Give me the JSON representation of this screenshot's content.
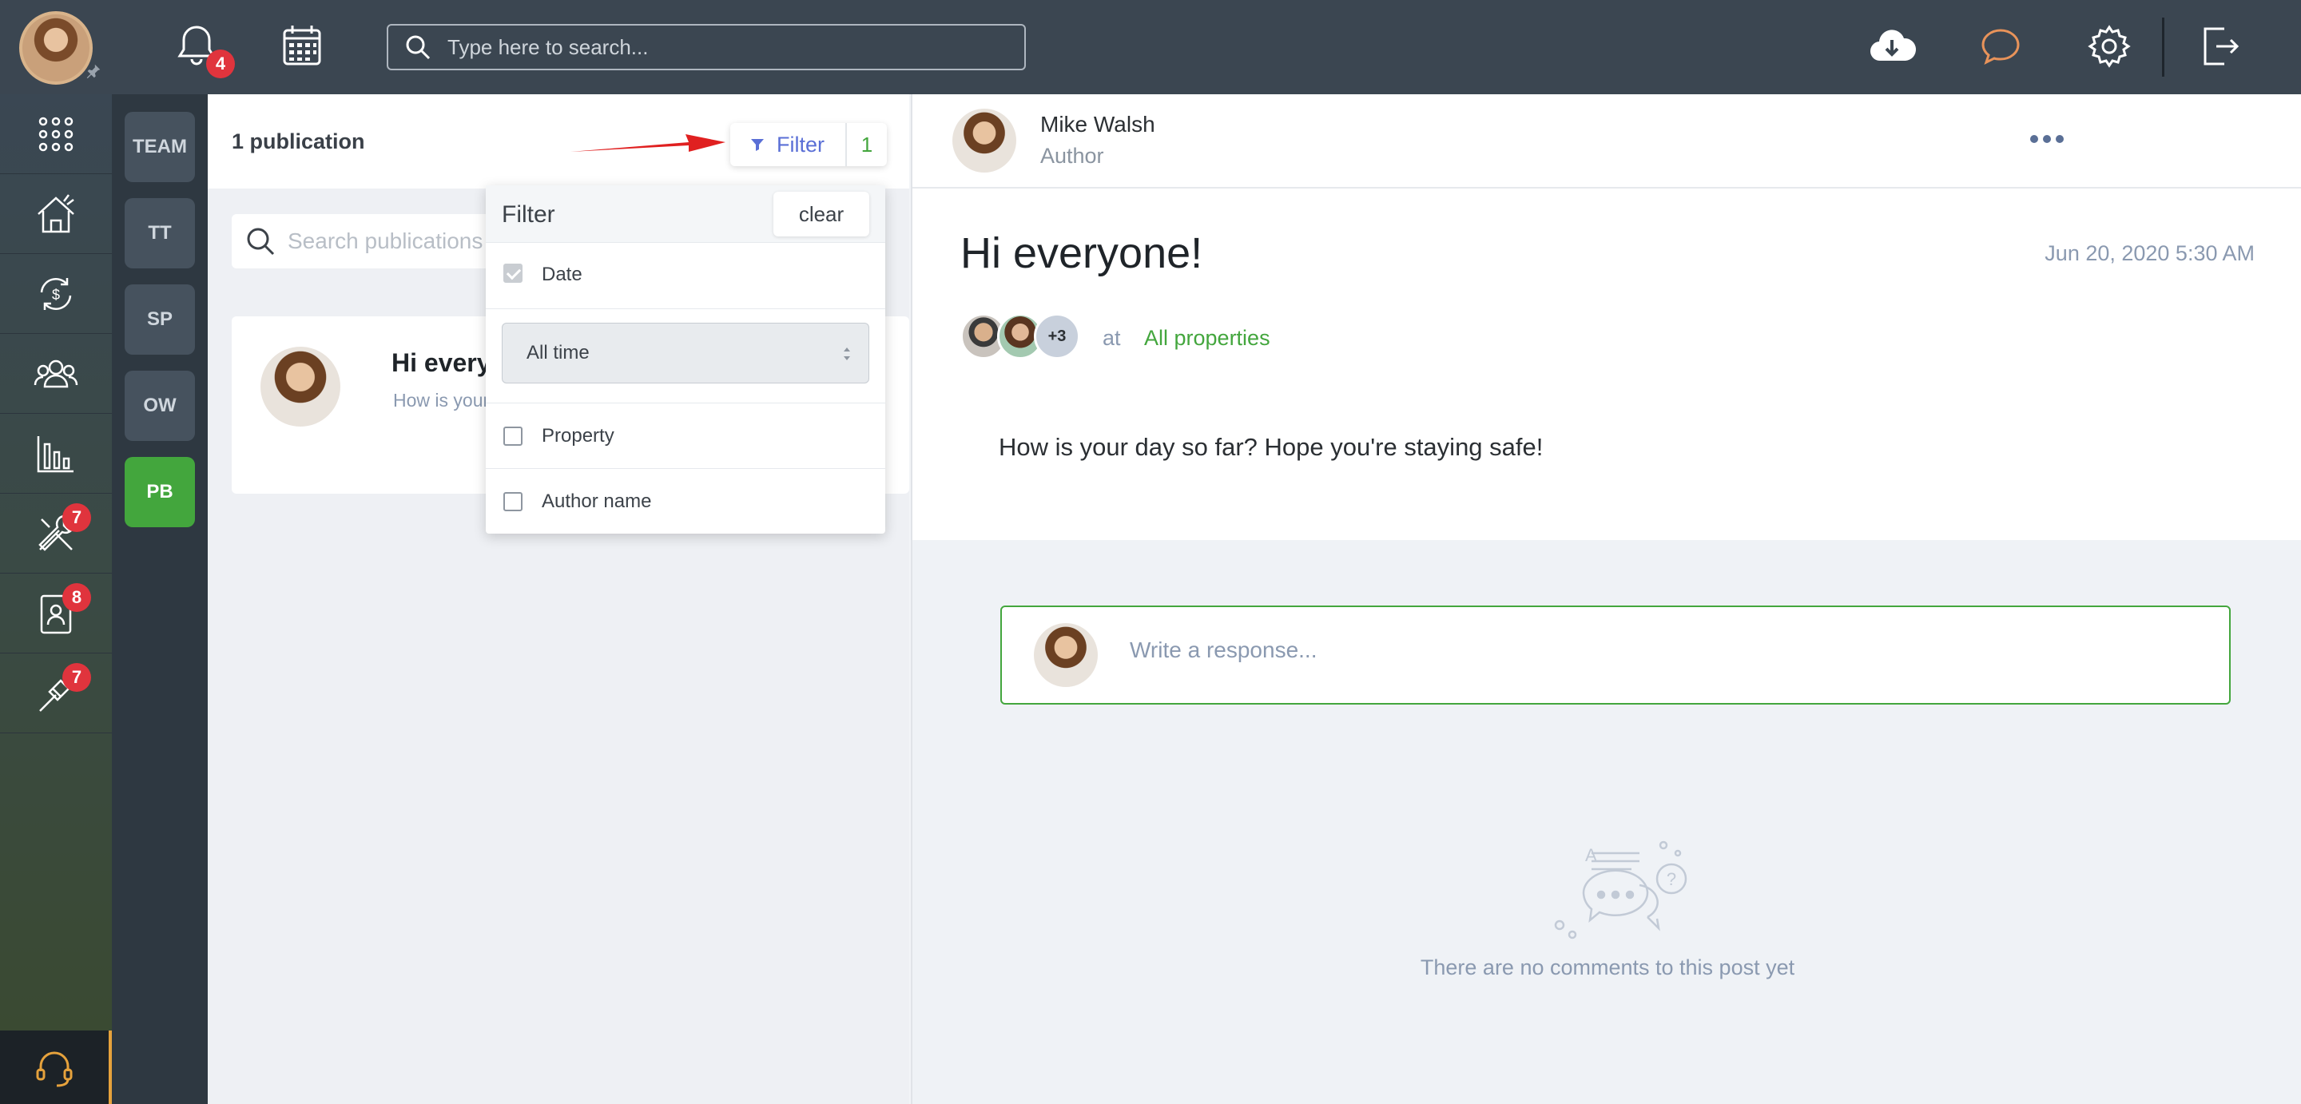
{
  "topbar": {
    "notifications_badge": "4",
    "search_placeholder": "Type here to search..."
  },
  "rail": {
    "badges": {
      "tools": "7",
      "contacts": "8",
      "tools2": "7"
    }
  },
  "workspaces": [
    {
      "label": "TEAM"
    },
    {
      "label": "TT"
    },
    {
      "label": "SP"
    },
    {
      "label": "OW"
    },
    {
      "label": "PB"
    }
  ],
  "publications": {
    "count_label": "1 publication",
    "filter_label": "Filter",
    "filter_count": "1",
    "search_placeholder": "Search publications",
    "card": {
      "title": "Hi everyone!",
      "preview": "How is your day so far? Hope you're staying safe!"
    }
  },
  "filter_dropdown": {
    "title": "Filter",
    "clear_label": "clear",
    "date_label": "Date",
    "date_checked": true,
    "date_range_value": "All time",
    "property_label": "Property",
    "author_label": "Author name"
  },
  "post": {
    "author_name": "Mike Walsh",
    "author_role": "Author",
    "title": "Hi everyone!",
    "date": "Jun 20, 2020 5:30 AM",
    "viewers_more": "+3",
    "at_text": "at",
    "properties_link": "All properties",
    "body": "How is your day so far? Hope you're staying safe!",
    "response_placeholder": "Write a response...",
    "empty_comments": "There are no comments to this post yet"
  },
  "colors": {
    "topbar_bg": "#3b4651",
    "accent_green": "#43a63d",
    "filter_blue": "#5a6fd6",
    "badge_red": "#e0343d",
    "chat_icon_orange": "#e8935a"
  }
}
